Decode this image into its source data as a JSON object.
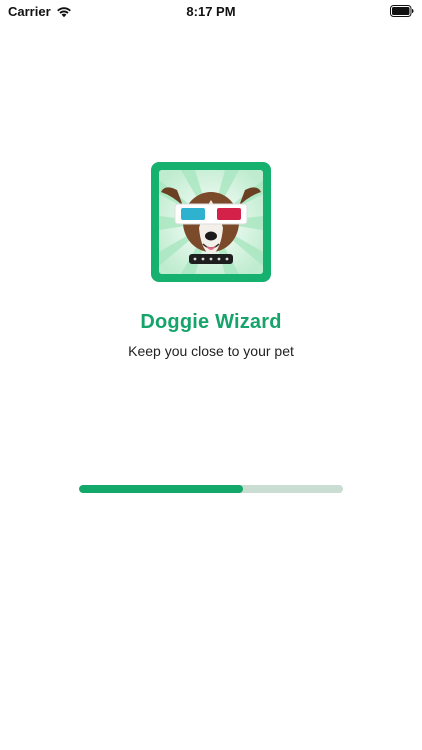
{
  "status_bar": {
    "carrier": "Carrier",
    "time": "8:17 PM",
    "wifi_icon": "wifi-icon",
    "battery_icon": "battery-icon"
  },
  "splash": {
    "app_icon": "dog-with-3d-glasses-icon",
    "app_name": "Doggie Wizard",
    "tagline": "Keep you close to your pet",
    "progress_fraction": 0.62
  },
  "colors": {
    "brand_green": "#16b06f",
    "title_green": "#17a46b",
    "progress_track": "#c9ddd3",
    "progress_fill": "#12a86a"
  }
}
